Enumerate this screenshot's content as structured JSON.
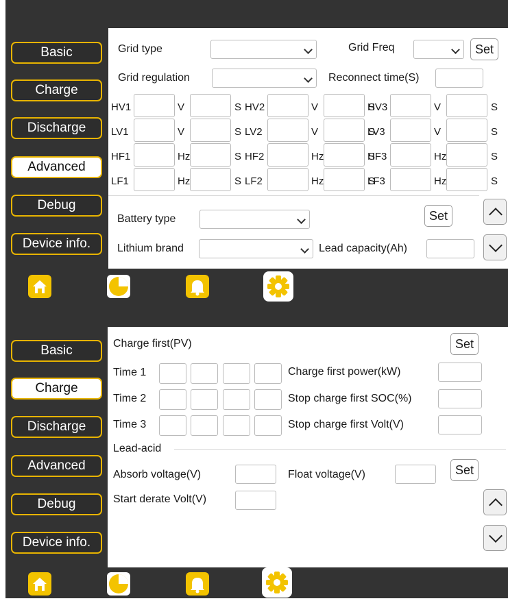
{
  "sidebar": {
    "items": [
      "Basic",
      "Charge",
      "Discharge",
      "Advanced",
      "Debug",
      "Device info."
    ]
  },
  "advanced_screen": {
    "active_tab": "Advanced",
    "grid_type_label": "Grid type",
    "grid_type_value": "",
    "grid_freq_label": "Grid Freq",
    "grid_freq_value": "",
    "grid_regulation_label": "Grid regulation",
    "grid_regulation_value": "",
    "reconnect_time_label": "Reconnect time(S)",
    "reconnect_time_value": "",
    "set_label": "Set",
    "protection_rows": [
      {
        "cells": [
          {
            "name": "HV1",
            "unit": "V"
          },
          {
            "name": "HV2",
            "unit": "V"
          },
          {
            "name": "HV3",
            "unit": "V"
          }
        ]
      },
      {
        "cells": [
          {
            "name": "LV1",
            "unit": "V"
          },
          {
            "name": "LV2",
            "unit": "V"
          },
          {
            "name": "LV3",
            "unit": "V"
          }
        ]
      },
      {
        "cells": [
          {
            "name": "HF1",
            "unit": "Hz"
          },
          {
            "name": "HF2",
            "unit": "Hz"
          },
          {
            "name": "HF3",
            "unit": "Hz"
          }
        ]
      },
      {
        "cells": [
          {
            "name": "LF1",
            "unit": "Hz"
          },
          {
            "name": "LF2",
            "unit": "Hz"
          },
          {
            "name": "LF3",
            "unit": "Hz"
          }
        ]
      }
    ],
    "seconds_unit": "S",
    "battery_type_label": "Battery type",
    "battery_type_value": "",
    "lithium_brand_label": "Lithium brand",
    "lithium_brand_value": "",
    "lead_capacity_label": "Lead capacity(Ah)",
    "lead_capacity_value": ""
  },
  "charge_screen": {
    "active_tab": "Charge",
    "charge_first_title": "Charge first(PV)",
    "set_label": "Set",
    "time_rows": [
      "Time 1",
      "Time 2",
      "Time 3"
    ],
    "charge_first_power_label": "Charge first power(kW)",
    "stop_charge_first_soc_label": "Stop charge first SOC(%)",
    "stop_charge_first_volt_label": "Stop charge first Volt(V)",
    "lead_acid_title": "Lead-acid",
    "absorb_voltage_label": "Absorb voltage(V)",
    "float_voltage_label": "Float voltage(V)",
    "start_derate_volt_label": "Start derate Volt(V)"
  },
  "bottom_nav": {
    "icons": [
      "home-icon",
      "pie-chart-icon",
      "bell-icon",
      "gear-icon"
    ],
    "active": "gear-icon"
  },
  "colors": {
    "panel_bg": "#333333",
    "accent": "#f3c300",
    "button_border": "#e8b400"
  }
}
